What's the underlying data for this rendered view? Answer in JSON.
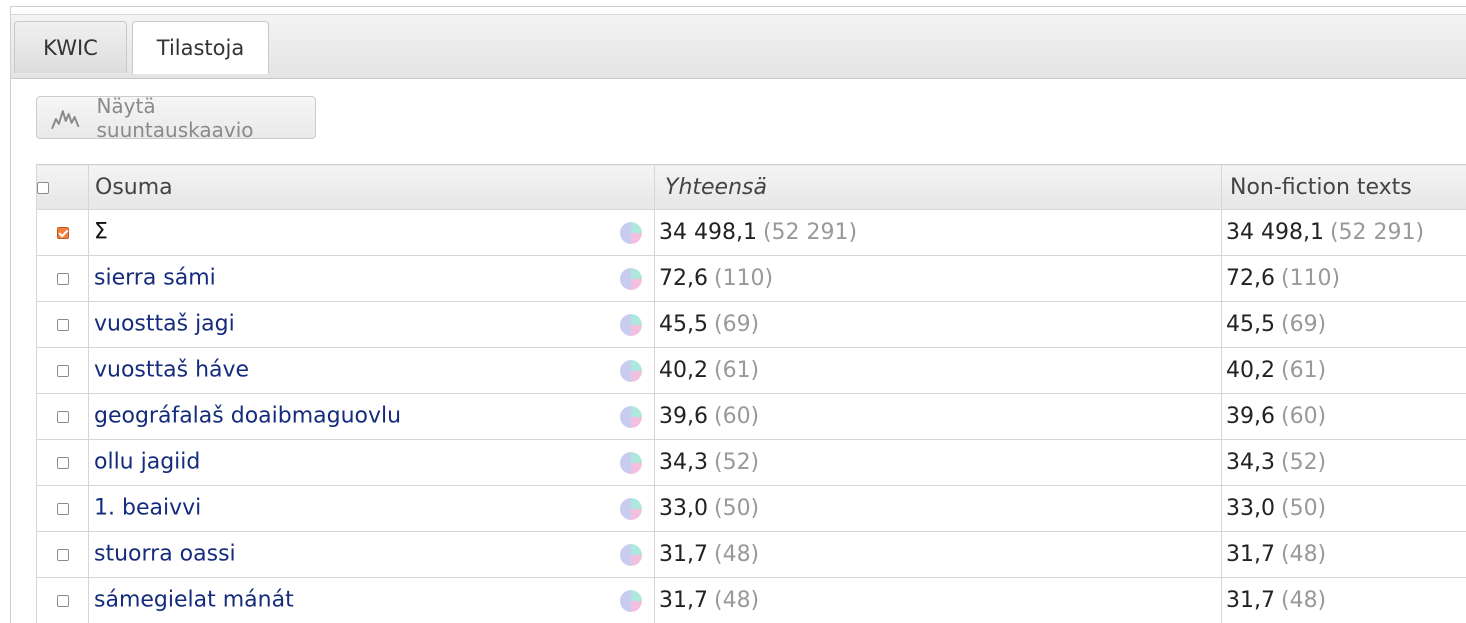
{
  "tabs": [
    {
      "label": "KWIC"
    },
    {
      "label": "Tilastoja"
    }
  ],
  "trend_button": {
    "label": "Näytä suuntauskaavio",
    "icon": "line-graph-icon"
  },
  "table": {
    "headers": {
      "hit": "Osuma",
      "total": "Yhteensä",
      "nonfiction": "Non-fiction texts"
    },
    "rows": [
      {
        "hit": "Σ",
        "checked": true,
        "total_rel": "34 498,1",
        "total_abs": "(52 291)",
        "nf_rel": "34 498,1",
        "nf_abs": "(52 291)"
      },
      {
        "hit": "sierra sámi",
        "checked": false,
        "total_rel": "72,6",
        "total_abs": "(110)",
        "nf_rel": "72,6",
        "nf_abs": "(110)"
      },
      {
        "hit": "vuosttaš jagi",
        "checked": false,
        "total_rel": "45,5",
        "total_abs": "(69)",
        "nf_rel": "45,5",
        "nf_abs": "(69)"
      },
      {
        "hit": "vuosttaš háve",
        "checked": false,
        "total_rel": "40,2",
        "total_abs": "(61)",
        "nf_rel": "40,2",
        "nf_abs": "(61)"
      },
      {
        "hit": "geográfalaš doaibmaguovlu",
        "checked": false,
        "total_rel": "39,6",
        "total_abs": "(60)",
        "nf_rel": "39,6",
        "nf_abs": "(60)"
      },
      {
        "hit": "ollu jagiid",
        "checked": false,
        "total_rel": "34,3",
        "total_abs": "(52)",
        "nf_rel": "34,3",
        "nf_abs": "(52)"
      },
      {
        "hit": "1. beaivvi",
        "checked": false,
        "total_rel": "33,0",
        "total_abs": "(50)",
        "nf_rel": "33,0",
        "nf_abs": "(50)"
      },
      {
        "hit": "stuorra oassi",
        "checked": false,
        "total_rel": "31,7",
        "total_abs": "(48)",
        "nf_rel": "31,7",
        "nf_abs": "(48)"
      },
      {
        "hit": "sámegielat mánát",
        "checked": false,
        "total_rel": "31,7",
        "total_abs": "(48)",
        "nf_rel": "31,7",
        "nf_abs": "(48)"
      }
    ]
  },
  "colors": {
    "hit_link": "#152c7c",
    "abs_count": "#999999",
    "checkbox_checked": "#f27e3c",
    "pie": [
      "#ace8dc",
      "#f2bfdf",
      "#c9ccf1"
    ]
  }
}
